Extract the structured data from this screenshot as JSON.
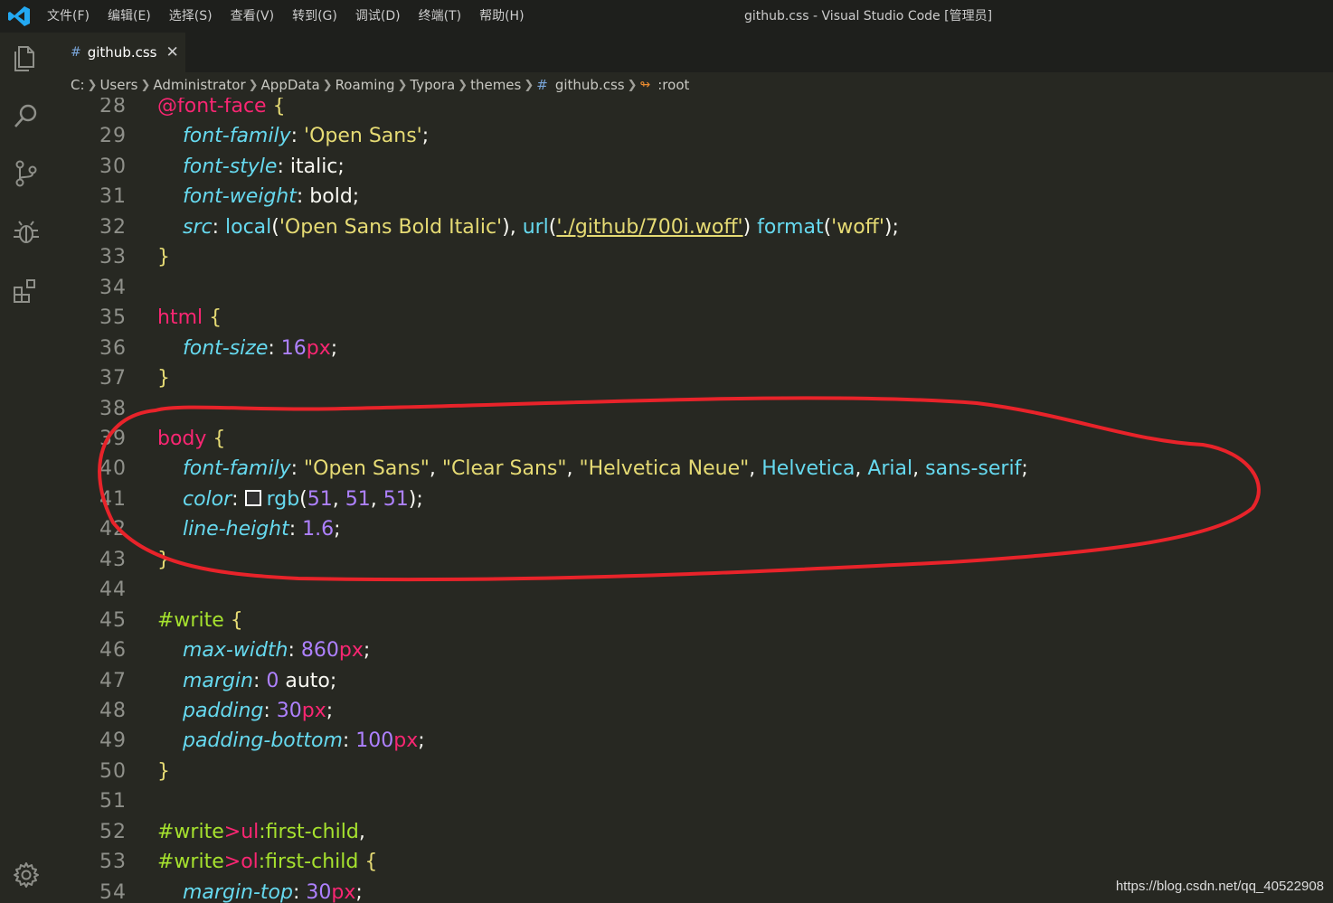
{
  "titlebar": {
    "menu": [
      "文件(F)",
      "编辑(E)",
      "选择(S)",
      "查看(V)",
      "转到(G)",
      "调试(D)",
      "终端(T)",
      "帮助(H)"
    ],
    "window_title": "github.css - Visual Studio Code [管理员]"
  },
  "activitybar": {
    "icons": [
      "explorer-icon",
      "search-icon",
      "source-control-icon",
      "debug-icon",
      "extensions-icon",
      "settings-gear-icon"
    ]
  },
  "tab": {
    "hash": "#",
    "label": "github.css",
    "close": "✕"
  },
  "breadcrumb": {
    "segments": [
      "C:",
      "Users",
      "Administrator",
      "AppData",
      "Roaming",
      "Typora",
      "themes"
    ],
    "file_hash": "#",
    "file": "github.css",
    "symbol_icon": "↬",
    "symbol": ":root"
  },
  "colors": {
    "editor_bg": "#272822",
    "titlebar_bg": "#1e1f1c",
    "annotation": "#e8232a",
    "swatch": "#333333"
  },
  "editor": {
    "lines": [
      {
        "n": "28",
        "tokens": [
          [
            "at",
            "@font-face"
          ],
          [
            "plain",
            " "
          ],
          [
            "brace",
            "{"
          ]
        ]
      },
      {
        "n": "29",
        "tokens": [
          [
            "plain",
            "    "
          ],
          [
            "prop",
            "font-family"
          ],
          [
            "punc",
            ": "
          ],
          [
            "str",
            "'Open Sans'"
          ],
          [
            "punc",
            ";"
          ]
        ]
      },
      {
        "n": "30",
        "tokens": [
          [
            "plain",
            "    "
          ],
          [
            "prop",
            "font-style"
          ],
          [
            "punc",
            ": "
          ],
          [
            "kw",
            "italic"
          ],
          [
            "punc",
            ";"
          ]
        ]
      },
      {
        "n": "31",
        "tokens": [
          [
            "plain",
            "    "
          ],
          [
            "prop",
            "font-weight"
          ],
          [
            "punc",
            ": "
          ],
          [
            "kw",
            "bold"
          ],
          [
            "punc",
            ";"
          ]
        ]
      },
      {
        "n": "32",
        "tokens": [
          [
            "plain",
            "    "
          ],
          [
            "prop",
            "src"
          ],
          [
            "punc",
            ": "
          ],
          [
            "fn",
            "local"
          ],
          [
            "paren",
            "("
          ],
          [
            "str",
            "'Open Sans Bold Italic'"
          ],
          [
            "paren",
            ")"
          ],
          [
            "punc",
            ", "
          ],
          [
            "fn",
            "url"
          ],
          [
            "paren",
            "("
          ],
          [
            "url",
            "'./github/700i.woff'"
          ],
          [
            "paren",
            ")"
          ],
          [
            "plain",
            " "
          ],
          [
            "fn",
            "format"
          ],
          [
            "paren",
            "("
          ],
          [
            "str",
            "'woff'"
          ],
          [
            "paren",
            ")"
          ],
          [
            "punc",
            ";"
          ]
        ]
      },
      {
        "n": "33",
        "tokens": [
          [
            "brace",
            "}"
          ]
        ]
      },
      {
        "n": "34",
        "tokens": []
      },
      {
        "n": "35",
        "tokens": [
          [
            "sel",
            "html"
          ],
          [
            "plain",
            " "
          ],
          [
            "brace",
            "{"
          ]
        ]
      },
      {
        "n": "36",
        "tokens": [
          [
            "plain",
            "    "
          ],
          [
            "prop",
            "font-size"
          ],
          [
            "punc",
            ": "
          ],
          [
            "num",
            "16"
          ],
          [
            "unit",
            "px"
          ],
          [
            "punc",
            ";"
          ]
        ]
      },
      {
        "n": "37",
        "tokens": [
          [
            "brace",
            "}"
          ]
        ]
      },
      {
        "n": "38",
        "tokens": []
      },
      {
        "n": "39",
        "tokens": [
          [
            "sel",
            "body"
          ],
          [
            "plain",
            " "
          ],
          [
            "brace",
            "{"
          ]
        ]
      },
      {
        "n": "40",
        "tokens": [
          [
            "plain",
            "    "
          ],
          [
            "prop",
            "font-family"
          ],
          [
            "punc",
            ": "
          ],
          [
            "str",
            "\"Open Sans\""
          ],
          [
            "punc",
            ", "
          ],
          [
            "str",
            "\"Clear Sans\""
          ],
          [
            "punc",
            ", "
          ],
          [
            "str",
            "\"Helvetica Neue\""
          ],
          [
            "punc",
            ", "
          ],
          [
            "const",
            "Helvetica"
          ],
          [
            "punc",
            ", "
          ],
          [
            "const",
            "Arial"
          ],
          [
            "punc",
            ", "
          ],
          [
            "const",
            "sans-serif"
          ],
          [
            "punc",
            ";"
          ]
        ]
      },
      {
        "n": "41",
        "tokens": [
          [
            "plain",
            "    "
          ],
          [
            "prop",
            "color"
          ],
          [
            "punc",
            ": "
          ],
          [
            "swatch",
            ""
          ],
          [
            "fn",
            "rgb"
          ],
          [
            "paren",
            "("
          ],
          [
            "num",
            "51"
          ],
          [
            "punc",
            ", "
          ],
          [
            "num",
            "51"
          ],
          [
            "punc",
            ", "
          ],
          [
            "num",
            "51"
          ],
          [
            "paren",
            ")"
          ],
          [
            "punc",
            ";"
          ]
        ]
      },
      {
        "n": "42",
        "tokens": [
          [
            "plain",
            "    "
          ],
          [
            "prop",
            "line-height"
          ],
          [
            "punc",
            ": "
          ],
          [
            "num",
            "1.6"
          ],
          [
            "punc",
            ";"
          ]
        ]
      },
      {
        "n": "43",
        "tokens": [
          [
            "brace",
            "}"
          ]
        ]
      },
      {
        "n": "44",
        "tokens": []
      },
      {
        "n": "45",
        "tokens": [
          [
            "id",
            "#write"
          ],
          [
            "plain",
            " "
          ],
          [
            "brace",
            "{"
          ]
        ]
      },
      {
        "n": "46",
        "tokens": [
          [
            "plain",
            "    "
          ],
          [
            "prop",
            "max-width"
          ],
          [
            "punc",
            ": "
          ],
          [
            "num",
            "860"
          ],
          [
            "unit",
            "px"
          ],
          [
            "punc",
            ";"
          ]
        ]
      },
      {
        "n": "47",
        "tokens": [
          [
            "plain",
            "    "
          ],
          [
            "prop",
            "margin"
          ],
          [
            "punc",
            ": "
          ],
          [
            "num",
            "0"
          ],
          [
            "plain",
            " "
          ],
          [
            "kw",
            "auto"
          ],
          [
            "punc",
            ";"
          ]
        ]
      },
      {
        "n": "48",
        "tokens": [
          [
            "plain",
            "    "
          ],
          [
            "prop",
            "padding"
          ],
          [
            "punc",
            ": "
          ],
          [
            "num",
            "30"
          ],
          [
            "unit",
            "px"
          ],
          [
            "punc",
            ";"
          ]
        ]
      },
      {
        "n": "49",
        "tokens": [
          [
            "plain",
            "    "
          ],
          [
            "prop",
            "padding-bottom"
          ],
          [
            "punc",
            ": "
          ],
          [
            "num",
            "100"
          ],
          [
            "unit",
            "px"
          ],
          [
            "punc",
            ";"
          ]
        ]
      },
      {
        "n": "50",
        "tokens": [
          [
            "brace",
            "}"
          ]
        ]
      },
      {
        "n": "51",
        "tokens": []
      },
      {
        "n": "52",
        "tokens": [
          [
            "id",
            "#write"
          ],
          [
            "combinator",
            ">"
          ],
          [
            "sel",
            "ul"
          ],
          [
            "pseudo",
            ":first-child"
          ],
          [
            "punc",
            ","
          ]
        ]
      },
      {
        "n": "53",
        "tokens": [
          [
            "id",
            "#write"
          ],
          [
            "combinator",
            ">"
          ],
          [
            "sel",
            "ol"
          ],
          [
            "pseudo",
            ":first-child"
          ],
          [
            "plain",
            " "
          ],
          [
            "brace",
            "{"
          ]
        ]
      },
      {
        "n": "54",
        "tokens": [
          [
            "plain",
            "    "
          ],
          [
            "prop",
            "margin-top"
          ],
          [
            "punc",
            ": "
          ],
          [
            "num",
            "30"
          ],
          [
            "unit",
            "px"
          ],
          [
            "punc",
            ";"
          ]
        ]
      }
    ]
  },
  "watermark": "https://blog.csdn.net/qq_40522908"
}
